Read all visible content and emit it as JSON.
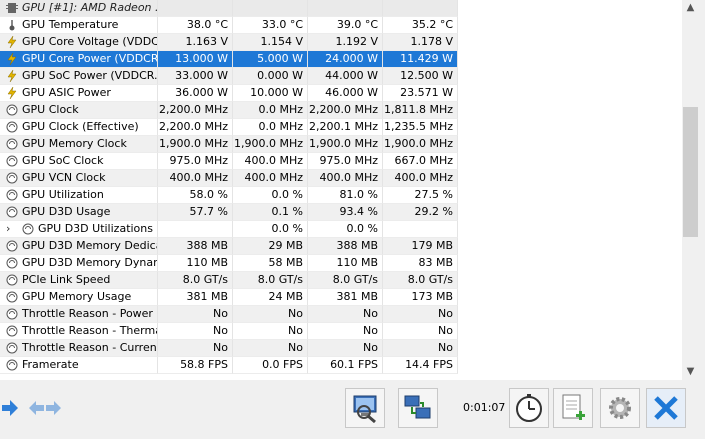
{
  "sensors": {
    "header": "GPU [#1]: AMD Radeon ...",
    "rows": [
      {
        "icon": "thermometer-icon",
        "label": "GPU Temperature",
        "values": [
          "38.0 °C",
          "33.0 °C",
          "39.0 °C",
          "35.2 °C"
        ]
      },
      {
        "icon": "lightning-icon",
        "label": "GPU Core Voltage (VDDC...",
        "values": [
          "1.163 V",
          "1.154 V",
          "1.192 V",
          "1.178 V"
        ]
      },
      {
        "icon": "lightning-icon",
        "label": "GPU Core Power (VDDCR...",
        "values": [
          "13.000 W",
          "5.000 W",
          "24.000 W",
          "11.429 W"
        ],
        "selected": true
      },
      {
        "icon": "lightning-icon",
        "label": "GPU SoC Power (VDDCR...",
        "values": [
          "33.000 W",
          "0.000 W",
          "44.000 W",
          "12.500 W"
        ]
      },
      {
        "icon": "lightning-icon",
        "label": "GPU ASIC Power",
        "values": [
          "36.000 W",
          "10.000 W",
          "46.000 W",
          "23.571 W"
        ]
      },
      {
        "icon": "clock-icon",
        "label": "GPU Clock",
        "values": [
          "2,200.0 MHz",
          "0.0 MHz",
          "2,200.0 MHz",
          "1,811.8 MHz"
        ]
      },
      {
        "icon": "clock-icon",
        "label": "GPU Clock (Effective)",
        "values": [
          "2,200.0 MHz",
          "0.0 MHz",
          "2,200.1 MHz",
          "1,235.5 MHz"
        ]
      },
      {
        "icon": "clock-icon",
        "label": "GPU Memory Clock",
        "values": [
          "1,900.0 MHz",
          "1,900.0 MHz",
          "1,900.0 MHz",
          "1,900.0 MHz"
        ]
      },
      {
        "icon": "clock-icon",
        "label": "GPU SoC Clock",
        "values": [
          "975.0 MHz",
          "400.0 MHz",
          "975.0 MHz",
          "667.0 MHz"
        ]
      },
      {
        "icon": "clock-icon",
        "label": "GPU VCN Clock",
        "values": [
          "400.0 MHz",
          "400.0 MHz",
          "400.0 MHz",
          "400.0 MHz"
        ]
      },
      {
        "icon": "clock-icon",
        "label": "GPU Utilization",
        "values": [
          "58.0 %",
          "0.0 %",
          "81.0 %",
          "27.5 %"
        ]
      },
      {
        "icon": "clock-icon",
        "label": "GPU D3D Usage",
        "values": [
          "57.7 %",
          "0.1 %",
          "93.4 %",
          "29.2 %"
        ]
      },
      {
        "icon": "clock-icon",
        "label": "GPU D3D Utilizations",
        "values": [
          "",
          "0.0 %",
          "0.0 %",
          ""
        ],
        "sub": true,
        "expander": "›"
      },
      {
        "icon": "clock-icon",
        "label": "GPU D3D Memory Dedica...",
        "values": [
          "388 MB",
          "29 MB",
          "388 MB",
          "179 MB"
        ]
      },
      {
        "icon": "clock-icon",
        "label": "GPU D3D Memory Dynamic",
        "values": [
          "110 MB",
          "58 MB",
          "110 MB",
          "83 MB"
        ]
      },
      {
        "icon": "clock-icon",
        "label": "PCIe Link Speed",
        "values": [
          "8.0 GT/s",
          "8.0 GT/s",
          "8.0 GT/s",
          "8.0 GT/s"
        ]
      },
      {
        "icon": "clock-icon",
        "label": "GPU Memory Usage",
        "values": [
          "381 MB",
          "24 MB",
          "381 MB",
          "173 MB"
        ]
      },
      {
        "icon": "clock-icon",
        "label": "Throttle Reason - Power",
        "values": [
          "No",
          "No",
          "No",
          "No"
        ]
      },
      {
        "icon": "clock-icon",
        "label": "Throttle Reason - Thermal",
        "values": [
          "No",
          "No",
          "No",
          "No"
        ]
      },
      {
        "icon": "clock-icon",
        "label": "Throttle Reason - Current",
        "values": [
          "No",
          "No",
          "No",
          "No"
        ]
      },
      {
        "icon": "clock-icon",
        "label": "Framerate",
        "values": [
          "58.8 FPS",
          "0.0 FPS",
          "60.1 FPS",
          "14.4 FPS"
        ]
      }
    ]
  },
  "toolbar": {
    "timer": "0:01:07",
    "buttons": [
      "network-sensors-icon",
      "network-icon",
      "clock-icon",
      "add-report-icon",
      "settings-gear-icon",
      "close-icon"
    ]
  },
  "colors": {
    "selected": "#1e78d6",
    "alt_row": "#f0f0f0"
  }
}
